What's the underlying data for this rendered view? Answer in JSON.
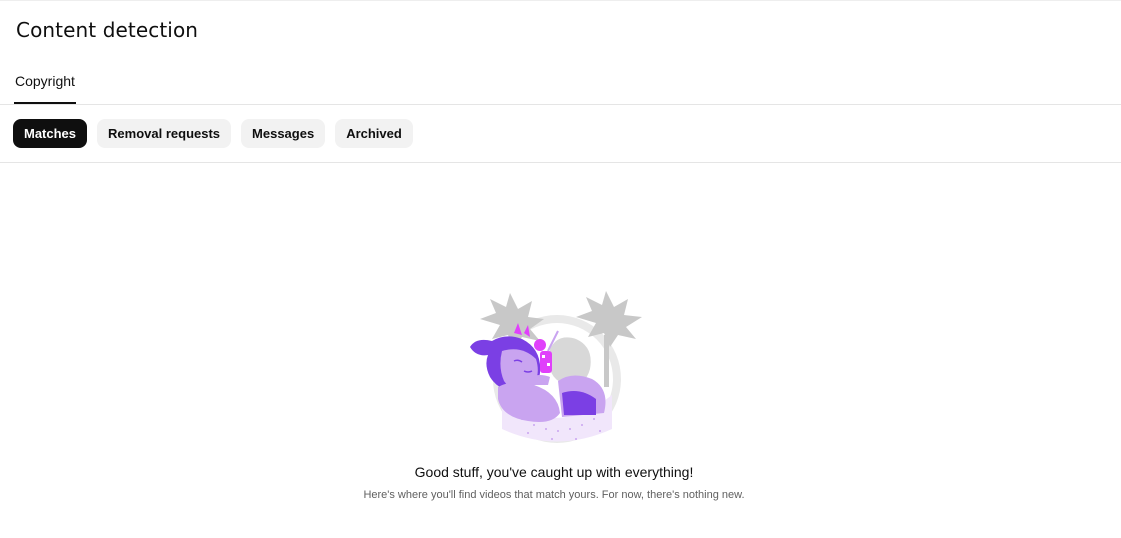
{
  "page": {
    "title": "Content detection"
  },
  "tabs": [
    {
      "label": "Copyright",
      "selected": true
    }
  ],
  "filter_chips": [
    {
      "label": "Matches",
      "selected": true
    },
    {
      "label": "Removal requests",
      "selected": false
    },
    {
      "label": "Messages",
      "selected": false
    },
    {
      "label": "Archived",
      "selected": false
    }
  ],
  "empty_state": {
    "illustration": "person-relaxing-with-drink-illustration",
    "title": "Good stuff, you've caught up with everything!",
    "subtitle": "Here's where you'll find videos that match yours. For now, there's nothing new."
  },
  "colors": {
    "chip_active_bg": "#0f0f0f",
    "chip_inactive_bg": "#f2f2f2",
    "illustration_purple": "#7b3fe4",
    "illustration_pink": "#e040fb"
  }
}
